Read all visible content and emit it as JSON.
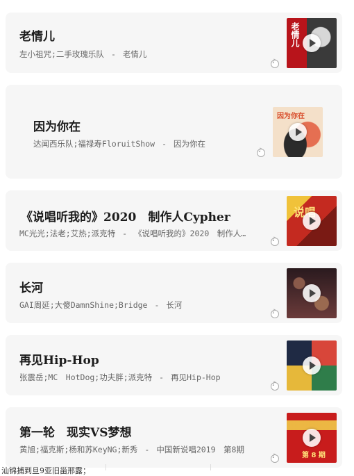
{
  "songs": [
    {
      "title": "老情儿",
      "subtitle": "左小祖咒;二手玫瑰乐队",
      "album": "老情儿",
      "cover_text": "老情儿",
      "colors": [
        "#b8141b",
        "#3a3a3a"
      ]
    },
    {
      "title": "因为你在",
      "subtitle": "达闻西乐队;福禄寿FloruitShow",
      "album": "因为你在",
      "cover_text": "因为你在",
      "colors": [
        "#f5ddc6",
        "#e9a08e"
      ]
    },
    {
      "title": "《说唱听我的》2020　制作人Cypher",
      "subtitle": "MC光光;法老;艾热;派克特",
      "album": "《说唱听我的》2020　制作人…",
      "cover_text": "说唱",
      "colors": [
        "#c42a20",
        "#f0c23a"
      ]
    },
    {
      "title": "长河",
      "subtitle": "GAI周延;大傻DamnShine;Bridge",
      "album": "长河",
      "cover_text": "",
      "colors": [
        "#2a1a1e",
        "#6b3b3a"
      ]
    },
    {
      "title": "再见Hip-Hop",
      "subtitle": "张震岳;MC　HotDog;功夫胖;派克特",
      "album": "再见Hip-Hop",
      "cover_text": "",
      "colors": [
        "#1f2a44",
        "#d8463a"
      ]
    },
    {
      "title": "第一轮　现实VS梦想",
      "subtitle": "黄旭;福克斯;杨和苏KeyNG;新秀",
      "album": "中国新说唱2019　第8期",
      "cover_text": "第 8 期",
      "colors": [
        "#c81c1c",
        "#f2d24a"
      ]
    }
  ],
  "separator": "-",
  "bottom_text": "汕锦捕到旦9亚旧甾邢露；"
}
